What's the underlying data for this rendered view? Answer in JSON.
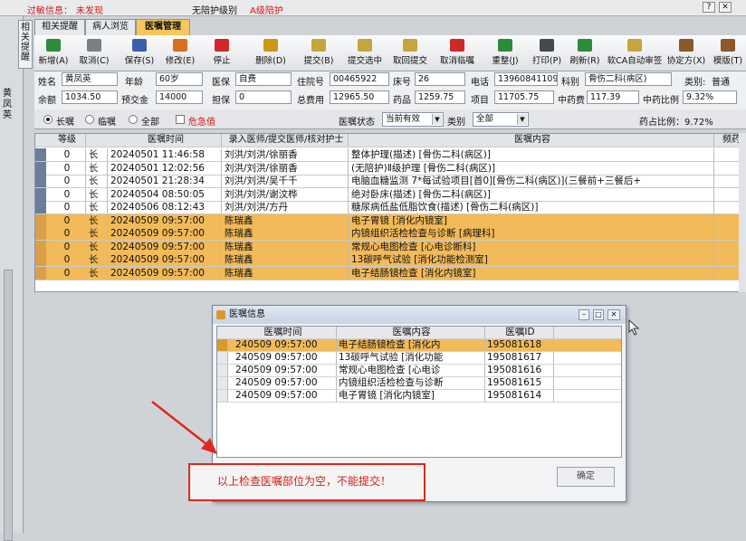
{
  "topbar": {
    "allergy_label": "过敏信息：",
    "allergy_value": "未发现",
    "care_level": "无陪护级别",
    "care_value": "A级陪护"
  },
  "side_tab": "相关提醒",
  "tabs": [
    {
      "label": "相关提醒"
    },
    {
      "label": "病人浏览"
    },
    {
      "label": "医嘱管理"
    }
  ],
  "toolbar": [
    {
      "label": "新增(A)",
      "color": "#2e8b3a",
      "icon": "plus-icon"
    },
    {
      "label": "取消(C)",
      "color": "#7a7f86",
      "icon": "undo-icon"
    },
    {
      "label": "保存(S)",
      "color": "#3b5fb0",
      "icon": "save-icon"
    },
    {
      "label": "修改(E)",
      "color": "#d96f1c",
      "icon": "edit-icon"
    },
    {
      "label": "停止",
      "color": "#d02828",
      "icon": "stop-icon"
    },
    {
      "label": "删除(D)",
      "color": "#c99a16",
      "icon": "delete-icon"
    },
    {
      "label": "提交(B)",
      "color": "#c4a73a",
      "icon": "submit-icon"
    },
    {
      "label": "提交选中",
      "color": "#c4a73a",
      "icon": "submit-selected-icon"
    },
    {
      "label": "取回提交",
      "color": "#c4a73a",
      "icon": "retrieve-icon"
    },
    {
      "label": "取消临嘱",
      "color": "#d02828",
      "icon": "cancel-icon"
    },
    {
      "label": "重整(J)",
      "color": "#2e8b3a",
      "icon": "reorganize-icon"
    },
    {
      "label": "打印(P)",
      "color": "#444a52",
      "icon": "print-icon"
    },
    {
      "label": "刷新(R)",
      "color": "#2e8b3a",
      "icon": "refresh-icon"
    },
    {
      "label": "软CA自动审签",
      "color": "#c4a73a",
      "icon": "ca-sign-icon"
    },
    {
      "label": "协定方(X)",
      "color": "#8a5a2a",
      "icon": "prescription-icon"
    },
    {
      "label": "模版(T)",
      "color": "#8a5a2a",
      "icon": "template-icon"
    }
  ],
  "patient": {
    "side_name": "黄凤英",
    "name_label": "姓名",
    "name": "黄凤英",
    "age_label": "年龄",
    "age": "60岁",
    "insurance_label": "医保",
    "insurance": "自费",
    "admission_label": "住院号",
    "admission_no": "00465922",
    "bed_label": "床号",
    "bed": "26",
    "phone_label": "电话",
    "phone": "13960841109",
    "dept_label": "科别",
    "dept": "骨伤二科(病区)",
    "category_label": "类别:",
    "category": "普通",
    "balance_label": "余额",
    "balance": "1034.50",
    "prepay_label": "预交金",
    "prepay": "14000",
    "guarantee_label": "担保",
    "guarantee": "0",
    "total_label": "总费用",
    "total": "12965.50",
    "drug_label": "药品",
    "drug": "1259.75",
    "item_label": "项目",
    "item": "11705.75",
    "tcm_label": "中药费",
    "tcm": "117.39",
    "tcm_ratio_label": "中药比例",
    "tcm_ratio": "9.32%"
  },
  "filter": {
    "long": "长嘱",
    "temp": "临嘱",
    "all": "全部",
    "critical": "危急值",
    "status_label": "医嘱状态",
    "status_value": "当前有效",
    "type_label": "类别",
    "type_value": "全部",
    "drug_ratio": "药占比例：9.72%"
  },
  "grid": {
    "headers": [
      "等级",
      "医嘱时间",
      "录入医师/提交医师/核对护士",
      "医嘱内容",
      "频药"
    ],
    "rows": [
      {
        "level": "0",
        "kind": "长",
        "time": "20240501 11:46:58",
        "doctor": "刘洪/刘洪/徐丽香",
        "content": "整体护理(描述)    [骨伤二科(病区)]",
        "orange": false
      },
      {
        "level": "0",
        "kind": "长",
        "time": "20240501 12:02:56",
        "doctor": "刘洪/刘洪/徐丽香",
        "content": "(无陪护)Ⅱ级护理    [骨伤二科(病区)]",
        "orange": false
      },
      {
        "level": "0",
        "kind": "长",
        "time": "20240501 21:28:34",
        "doctor": "刘洪/刘洪/吴千千",
        "content": "电脑血糖监测    7*每试验项目[首0][骨伤二科(病区)](三餐前+三餐后+",
        "orange": false
      },
      {
        "level": "0",
        "kind": "长",
        "time": "20240504 08:50:05",
        "doctor": "刘洪/刘洪/谢汶桦",
        "content": "绝对卧床(描述)    [骨伤二科(病区)]",
        "orange": false
      },
      {
        "level": "0",
        "kind": "长",
        "time": "20240506 08:12:43",
        "doctor": "刘洪/刘洪/方丹",
        "content": "糖尿病低盐低脂饮食(描述)    [骨伤二科(病区)]",
        "orange": false
      },
      {
        "level": "0",
        "kind": "长",
        "time": "20240509 09:57:00",
        "doctor": "陈瑞鑫",
        "content": "电子胃镜    [消化内镜室]",
        "orange": true
      },
      {
        "level": "0",
        "kind": "长",
        "time": "20240509 09:57:00",
        "doctor": "陈瑞鑫",
        "content": "内镜组织活检检查与诊断    [病理科]",
        "orange": true
      },
      {
        "level": "0",
        "kind": "长",
        "time": "20240509 09:57:00",
        "doctor": "陈瑞鑫",
        "content": "常规心电图检查    [心电诊断科]",
        "orange": true
      },
      {
        "level": "0",
        "kind": "长",
        "time": "20240509 09:57:00",
        "doctor": "陈瑞鑫",
        "content": "13碳呼气试验    [消化功能检测室]",
        "orange": true
      },
      {
        "level": "0",
        "kind": "长",
        "time": "20240509 09:57:00",
        "doctor": "陈瑞鑫",
        "content": "电子结肠镜检查    [消化内镜室]",
        "orange": true
      }
    ]
  },
  "dialog": {
    "title": "医嘱信息",
    "headers": [
      "医嘱时间",
      "医嘱内容",
      "医嘱ID"
    ],
    "rows": [
      {
        "time": "240509 09:57:00",
        "content": "电子结肠镜检查    [消化内",
        "id": "195081618",
        "selected": true
      },
      {
        "time": "240509 09:57:00",
        "content": "13碳呼气试验    [消化功能",
        "id": "195081617",
        "selected": false
      },
      {
        "time": "240509 09:57:00",
        "content": "常规心电图检查    [心电诊",
        "id": "195081616",
        "selected": false
      },
      {
        "time": "240509 09:57:00",
        "content": "内镜组织活检检查与诊断",
        "id": "195081615",
        "selected": false
      },
      {
        "time": "240509 09:57:00",
        "content": "电子胃镜    [消化内镜室]",
        "id": "195081614",
        "selected": false
      }
    ],
    "message": "以上检查医嘱部位为空，不能提交！",
    "ok": "确定"
  }
}
